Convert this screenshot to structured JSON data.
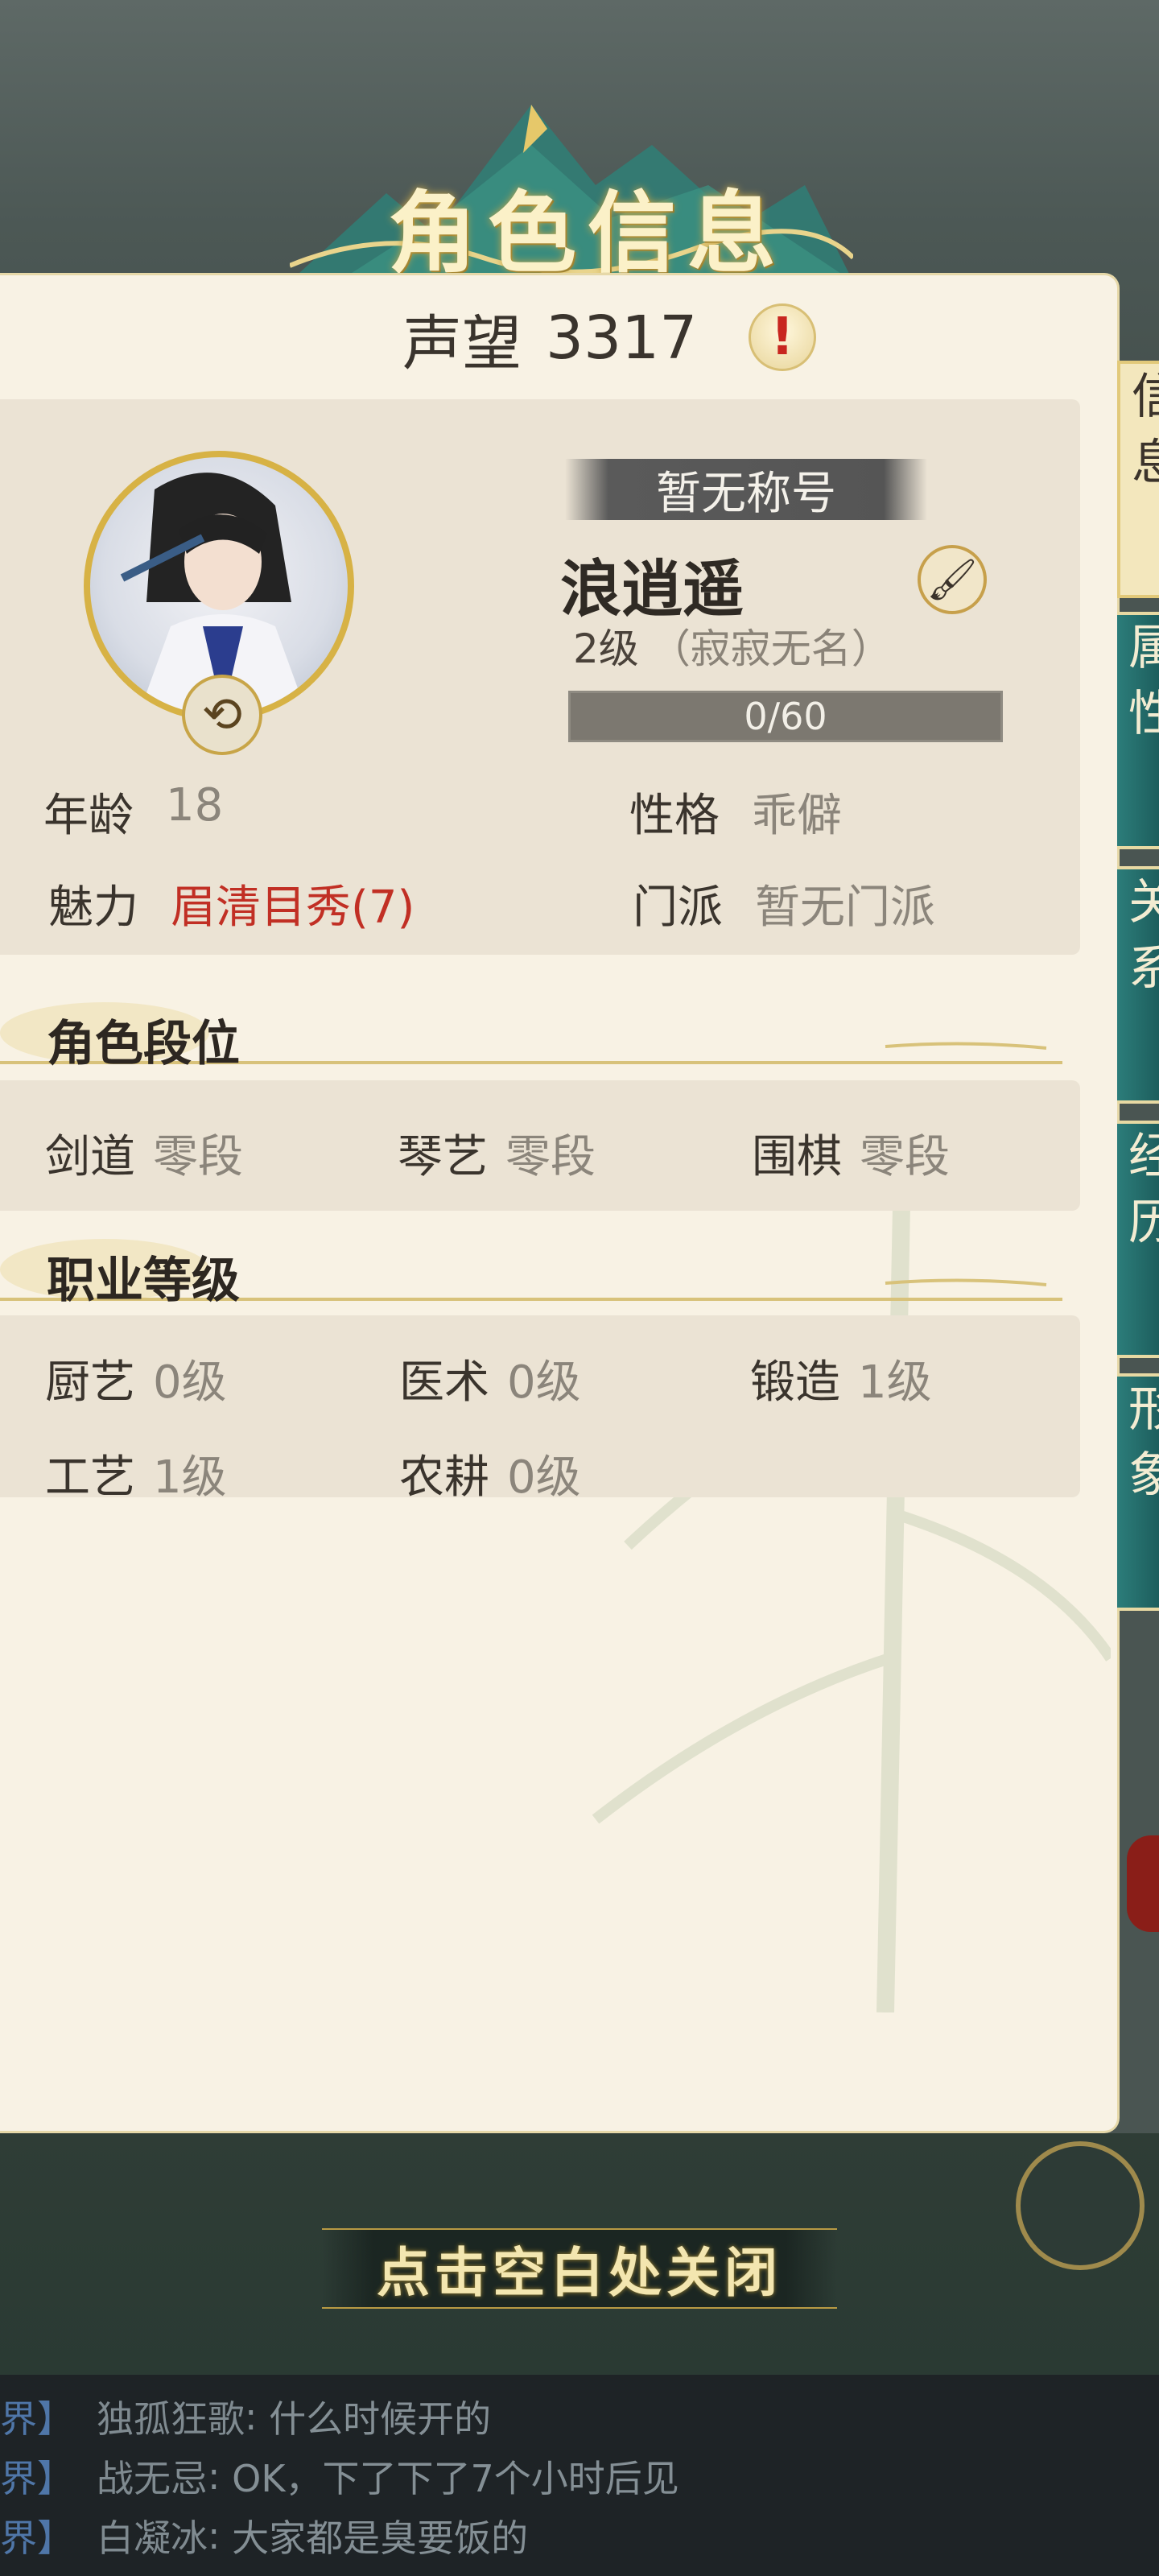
{
  "header": {
    "title": "角色信息"
  },
  "prestige": {
    "label": "声望",
    "value": "3317",
    "alert_icon": "exclamation-icon"
  },
  "character": {
    "title_badge": "暂无称号",
    "name": "浪逍遥",
    "level": "2级",
    "level_note": "（寂寂无名）",
    "xp_text": "0/60",
    "xp_progress": 0
  },
  "attributes": {
    "age_label": "年龄",
    "age_value": "18",
    "personality_label": "性格",
    "personality_value": "乖僻",
    "charm_label": "魅力",
    "charm_value": "眉清目秀(7)",
    "sect_label": "门派",
    "sect_value": "暂无门派"
  },
  "rank_section": {
    "title": "角色段位",
    "items": [
      {
        "label": "剑道",
        "value": "零段"
      },
      {
        "label": "琴艺",
        "value": "零段"
      },
      {
        "label": "围棋",
        "value": "零段"
      }
    ]
  },
  "job_section": {
    "title": "职业等级",
    "items": [
      {
        "label": "厨艺",
        "value": "0级"
      },
      {
        "label": "医术",
        "value": "0级"
      },
      {
        "label": "锻造",
        "value": "1级"
      },
      {
        "label": "工艺",
        "value": "1级"
      },
      {
        "label": "农耕",
        "value": "0级"
      }
    ]
  },
  "side_tabs": [
    {
      "label": "信息"
    },
    {
      "label": "属性"
    },
    {
      "label": "关系"
    },
    {
      "label": "经历"
    },
    {
      "label": "形象"
    }
  ],
  "close_hint": "点击空白处关闭",
  "chat": [
    {
      "channel": "界】",
      "sender": "独孤狂歌",
      "message": "什么时候开的"
    },
    {
      "channel": "界】",
      "sender": "战无忌",
      "message": "OK，下了下了7个小时后见"
    },
    {
      "channel": "界】",
      "sender": "白凝冰",
      "message": "大家都是臭要饭的"
    }
  ],
  "colors": {
    "panel_bg": "#f8f2e4",
    "card_bg": "#ebe3d4",
    "tab_teal": "#2c7d7a",
    "charm_red": "#c12f24",
    "gold": "#d7b245"
  }
}
